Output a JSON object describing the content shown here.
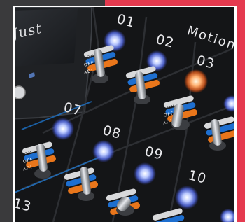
{
  "display": {
    "text": "Just"
  },
  "header": {
    "title": "Motion"
  },
  "channels": [
    {
      "number": "01",
      "led": "blue",
      "switch": "ADJ"
    },
    {
      "number": "02",
      "led": "blue",
      "switch": "ADJ"
    },
    {
      "number": "03",
      "led": "orange",
      "switch": "ON"
    },
    {
      "number": "07",
      "led": "blue",
      "switch": "ADJ"
    },
    {
      "number": "08",
      "led": "blue",
      "switch": "ADJ"
    },
    {
      "number": "09",
      "led": "blue",
      "switch": "ON"
    },
    {
      "number": "10",
      "led": "blue",
      "switch": "ON"
    },
    {
      "number": "13",
      "led": "none",
      "switch": ""
    }
  ],
  "switch_labels": {
    "on": "ON",
    "off": "OFF",
    "adj": "ADJ"
  },
  "colors": {
    "led_blue": "#6f8dff",
    "led_orange": "#ff8a3c",
    "accent_blue": "#1e7fe0",
    "accent_orange": "#e9761b",
    "background_red": "#e53a4f"
  }
}
